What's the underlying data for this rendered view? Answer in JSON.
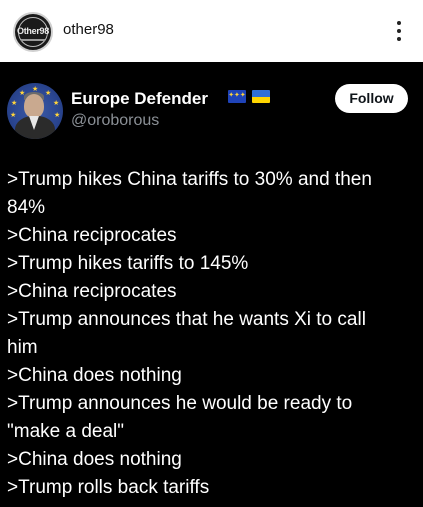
{
  "header": {
    "username": "other98",
    "avatar_icon": "other98-logo-icon",
    "avatar_text": "Other98",
    "more_icon": "vertical-ellipsis-icon"
  },
  "post": {
    "author_name": "Europe Defender",
    "author_handle": "@oroborous",
    "flags": [
      "eu-flag-icon",
      "ukraine-flag-icon"
    ],
    "follow_label": "Follow",
    "lines": [
      ">Trump hikes China tariffs to 30% and then",
      "84%",
      ">China reciprocates",
      ">Trump hikes tariffs to 145%",
      ">China reciprocates",
      ">Trump announces that he wants Xi to call",
      "him",
      ">China does nothing",
      ">Trump announces he would be ready to",
      "\"make a deal\"",
      ">China does nothing",
      ">Trump rolls back tariffs"
    ]
  },
  "colors": {
    "post_background": "#000000",
    "header_background": "#ffffff",
    "handle_gray": "#8b9096",
    "eu_blue": "#1f43b8",
    "ua_blue": "#2f6fd6",
    "ua_yellow": "#ffd500"
  }
}
